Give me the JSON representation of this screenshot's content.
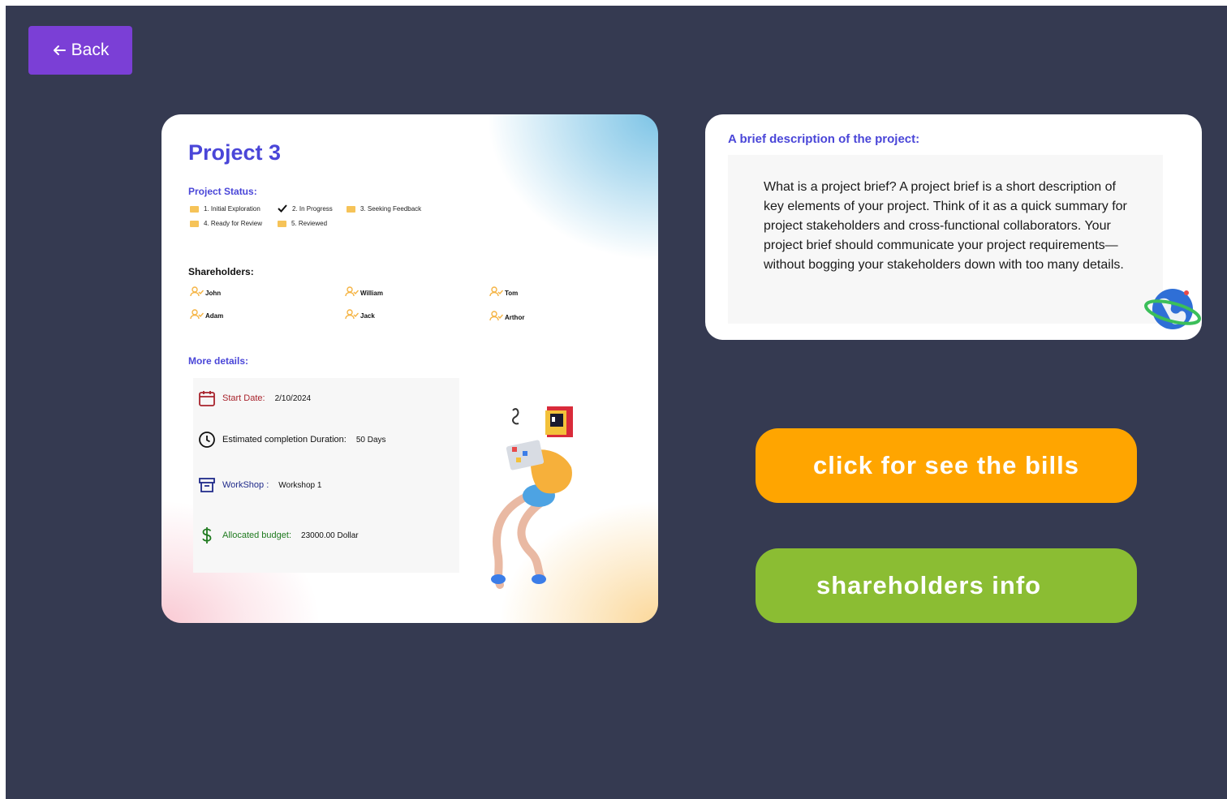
{
  "back_button": {
    "label": "Back",
    "icon": "arrow-left-icon"
  },
  "project": {
    "title": "Project 3",
    "status_label": "Project Status:",
    "statuses": [
      {
        "label": "1. Initial Exploration",
        "checked": false
      },
      {
        "label": "2. In Progress",
        "checked": true
      },
      {
        "label": "3. Seeking Feedback",
        "checked": false
      },
      {
        "label": "4. Ready for Review",
        "checked": false
      },
      {
        "label": "5. Reviewed",
        "checked": false
      }
    ],
    "shareholders_label": "Shareholders:",
    "shareholders": [
      "John",
      "William",
      "Tom",
      "Adam",
      "Jack",
      "Arthor"
    ],
    "more_details_label": "More details:",
    "details": {
      "start_date_label": "Start Date:",
      "start_date": "2/10/2024",
      "duration_label": "Estimated completion Duration:",
      "duration": "50 Days",
      "workshop_label": "WorkShop :",
      "workshop": "Workshop 1",
      "budget_label": "Allocated budget:",
      "budget": "23000.00 Dollar"
    }
  },
  "description": {
    "title": "A brief description of the project:",
    "text": "What is a project brief? A project brief is a short description of key elements of your project. Think of it as a quick summary for project stakeholders and cross-functional collaborators. Your project brief should communicate your project requirements—without bogging your stakeholders down with too many details."
  },
  "buttons": {
    "bills": "click for see the bills",
    "shareholders": "shareholders info"
  },
  "colors": {
    "background": "#353a51",
    "back_button": "#7b3fd6",
    "accent_text": "#4a46d8",
    "bills_button": "#ffa500",
    "shareholders_button": "#8bbd33",
    "status_box": "#f6c358"
  }
}
